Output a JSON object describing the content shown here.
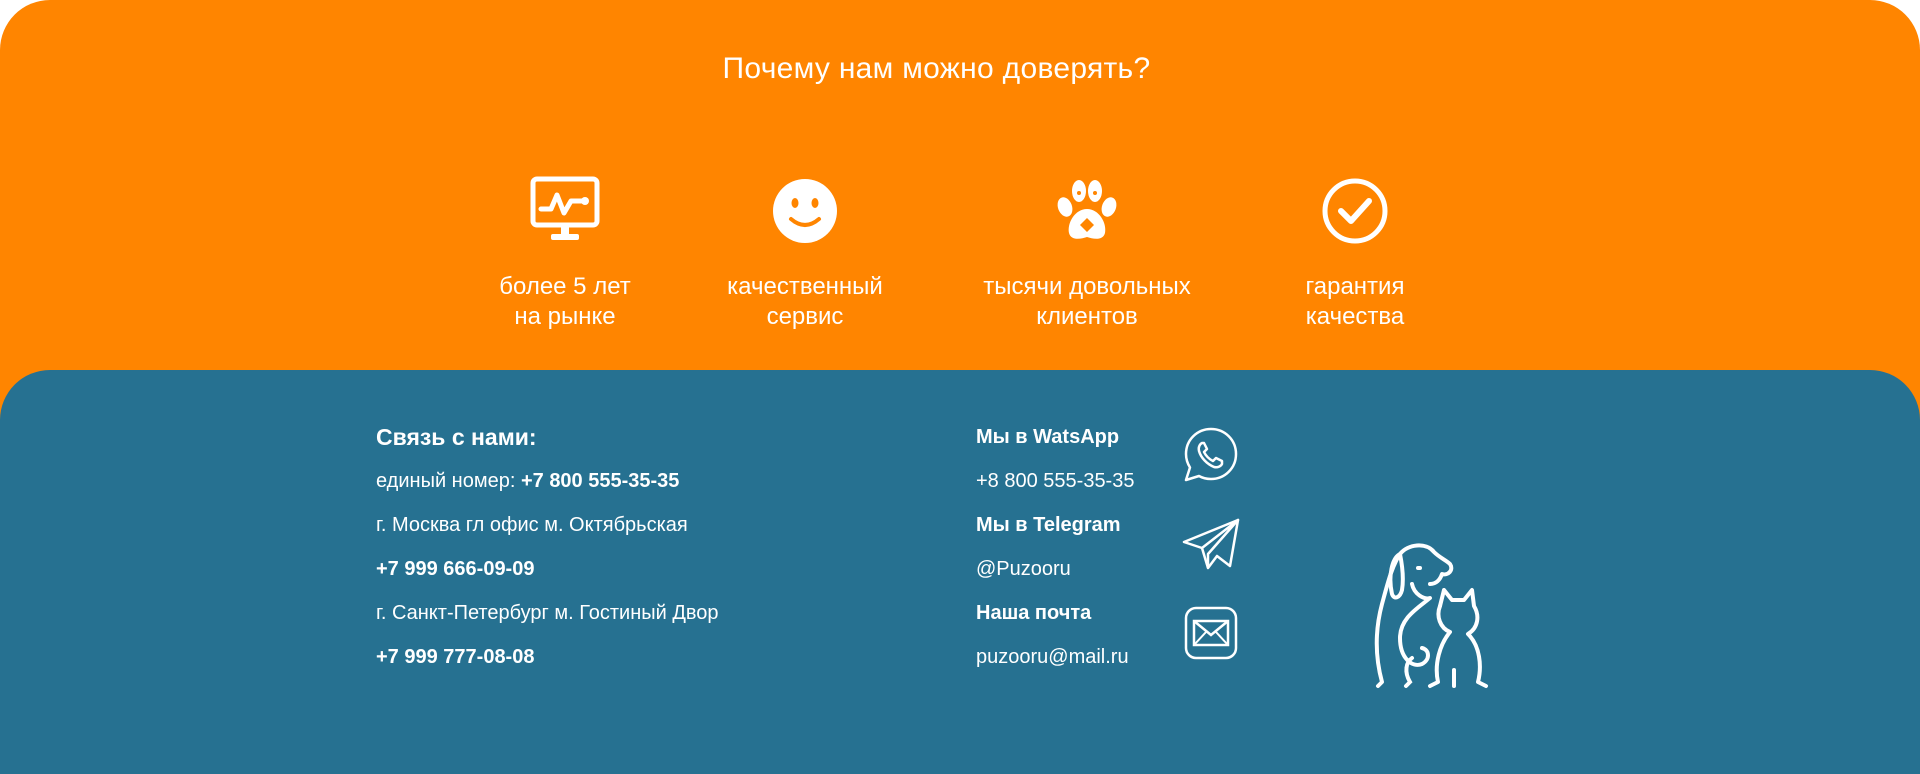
{
  "trust": {
    "title": "Почему нам можно доверять?",
    "features": [
      {
        "icon": "monitor-chart-icon",
        "label": "более 5 лет\nна рынке"
      },
      {
        "icon": "smiley-face-icon",
        "label": "качественный\nсервис"
      },
      {
        "icon": "paw-icon",
        "label": "тысячи довольных\nклиентов"
      },
      {
        "icon": "checkmark-circle-icon",
        "label": "гарантия\nкачества"
      }
    ]
  },
  "contacts": {
    "heading": "Связь с нами:",
    "single_number_label": "единый номер: ",
    "single_number": "+7 800 555-35-35",
    "moscow_address": "г. Москва гл офис м. Октябрьская",
    "moscow_phone": "+7 999 666-09-09",
    "spb_address": "г. Санкт-Петербург м. Гостиный Двор",
    "spb_phone": "+7 999 777-08-08"
  },
  "messengers": {
    "whatsapp_caption": "Мы в WatsApp",
    "whatsapp_value": "+8 800 555-35-35",
    "telegram_caption": "Мы в Telegram",
    "telegram_value": "@Puzooru",
    "email_caption": "Наша почта",
    "email_value": "puzooru@mail.ru"
  },
  "colors": {
    "accent_orange": "#ff8500",
    "footer_blue": "#267191",
    "text": "#ffffff"
  }
}
